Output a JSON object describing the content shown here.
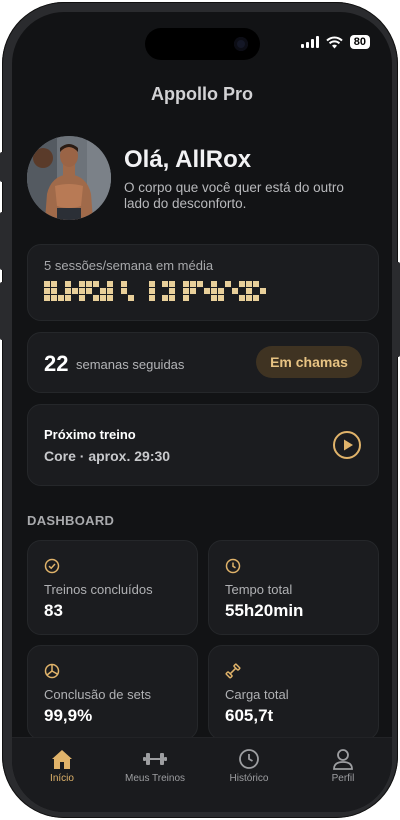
{
  "status": {
    "battery": "80"
  },
  "app_title": "Appollo Pro",
  "user": {
    "greeting": "Olá, AllRox",
    "quote": "O corpo que você quer está do outro lado do desconforto."
  },
  "average": {
    "label": "5 sessões/semana em média",
    "activity_rows": [
      "##.#.###.#.#...###.###.#.#.###",
      "##.####.##.#...#.#.##.###.#.#.#",
      "####.#.###..#..###.#...##..###"
    ]
  },
  "streak": {
    "value": "22",
    "label": "semanas seguidas",
    "badge": "Em chamas"
  },
  "next_workout": {
    "title": "Próximo treino",
    "detail": "Core · aprox. 29:30"
  },
  "dashboard": {
    "title": "DASHBOARD",
    "stats": [
      {
        "icon": "check-circle-icon",
        "label": "Treinos concluídos",
        "value": "83"
      },
      {
        "icon": "clock-icon",
        "label": "Tempo total",
        "value": "55h20min"
      },
      {
        "icon": "pie-chart-icon",
        "label": "Conclusão de sets",
        "value": "99,9%"
      },
      {
        "icon": "dumbbell-icon",
        "label": "Carga total",
        "value": "605,7t"
      }
    ]
  },
  "tabs": [
    {
      "label": "Início",
      "icon": "home-icon",
      "active": true
    },
    {
      "label": "Meus Treinos",
      "icon": "dumbbell-icon",
      "active": false
    },
    {
      "label": "Histórico",
      "icon": "clock-icon",
      "active": false
    },
    {
      "label": "Perfil",
      "icon": "user-icon",
      "active": false
    }
  ],
  "colors": {
    "accent": "#e0b36a",
    "background": "#121315",
    "card": "#1b1c1f",
    "badge_bg": "#3f3322"
  }
}
